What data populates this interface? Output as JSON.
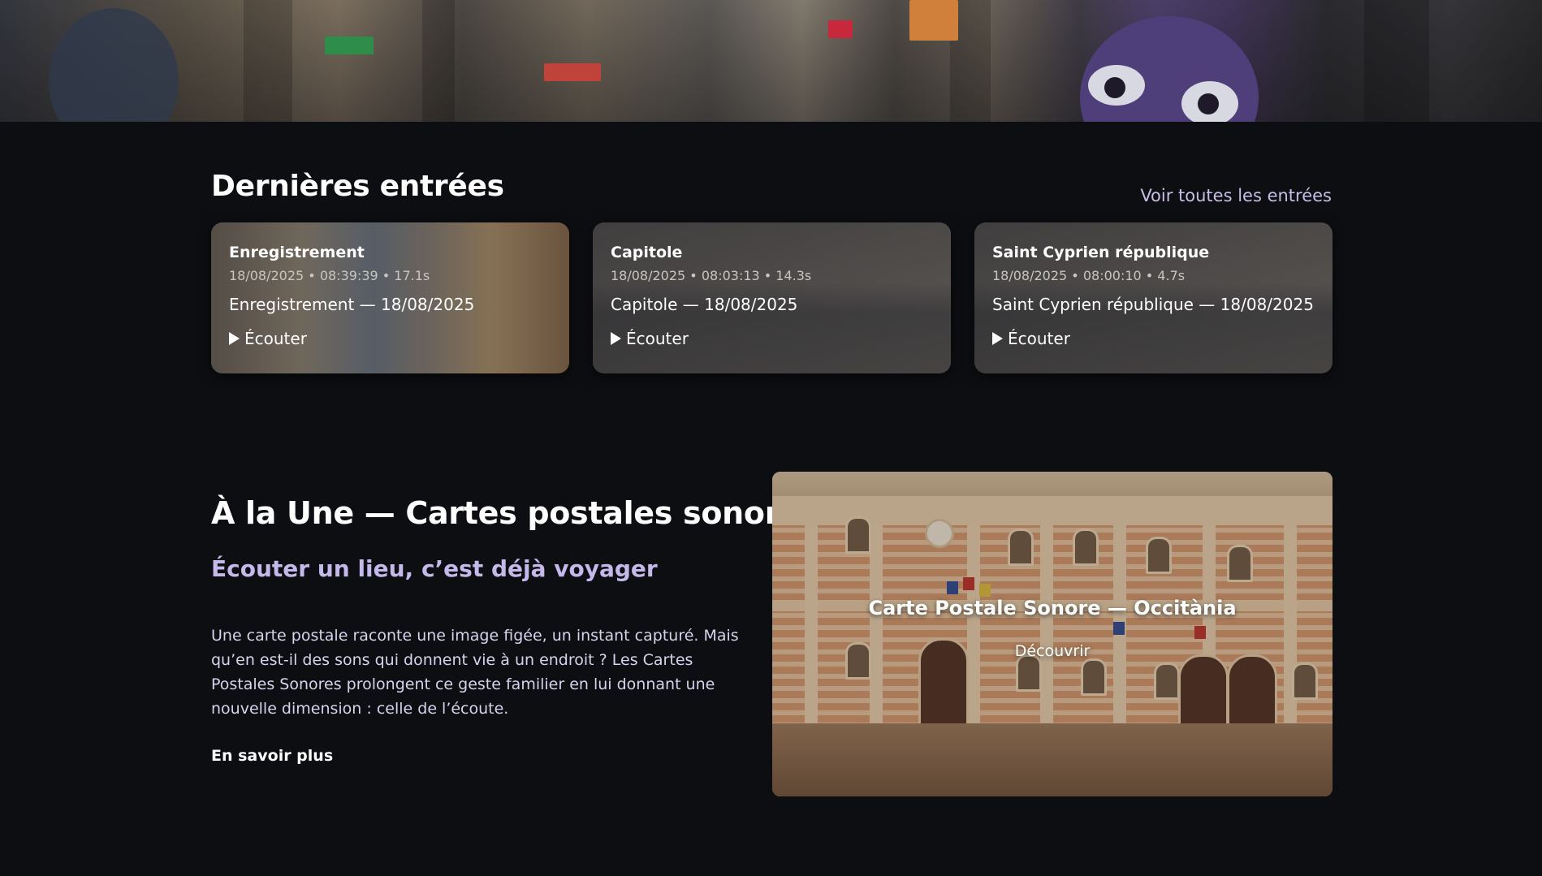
{
  "latest": {
    "title": "Dernières entrées",
    "see_all": "Voir toutes les entrées",
    "cards": [
      {
        "title": "Enregistrement",
        "meta": "18/08/2025 • 08:39:39 • 17.1s",
        "subtitle": "Enregistrement — 18/08/2025",
        "play_label": "Écouter"
      },
      {
        "title": "Capitole",
        "meta": "18/08/2025 • 08:03:13 • 14.3s",
        "subtitle": "Capitole — 18/08/2025",
        "play_label": "Écouter"
      },
      {
        "title": "Saint Cyprien république",
        "meta": "18/08/2025 • 08:00:10 • 4.7s",
        "subtitle": "Saint Cyprien république — 18/08/2025",
        "play_label": "Écouter"
      }
    ]
  },
  "feature": {
    "title": "À la Une — Cartes postales sonores",
    "subtitle": "Écouter un lieu, c’est déjà voyager",
    "body": "Une carte postale raconte une image figée, un instant capturé. Mais qu’en est-il des sons qui donnent vie à un endroit ? Les Cartes Postales Sonores prolongent ce geste familier en lui donnant une nouvelle dimension : celle de l’écoute.",
    "link": "En savoir plus",
    "postcard": {
      "title": "Carte Postale Sonore — Occitània",
      "link": "Découvrir"
    }
  },
  "colors": {
    "background": "#0d0e11",
    "accent": "#c5b8ea",
    "text": "#ffffff"
  },
  "icons": {
    "play": "play-icon"
  }
}
